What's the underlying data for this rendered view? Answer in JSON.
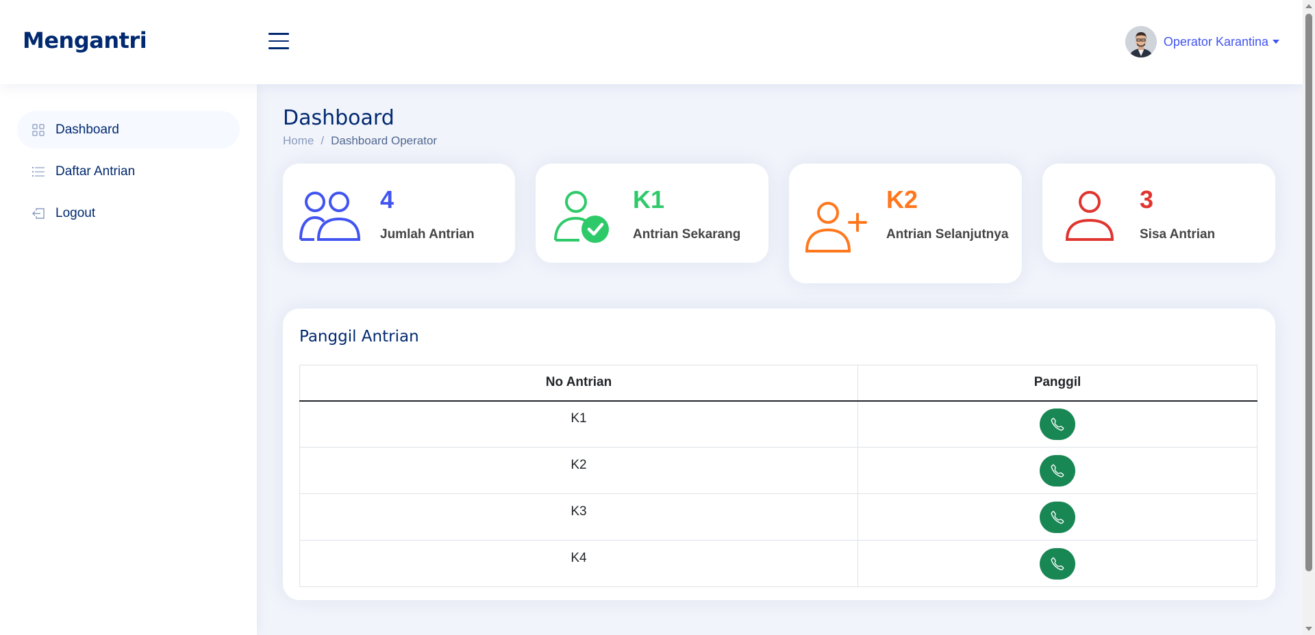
{
  "header": {
    "logo": "Mengantri",
    "profile_name": "Operator Karantina"
  },
  "sidebar": {
    "items": [
      {
        "label": "Dashboard",
        "icon": "grid-icon",
        "active": true
      },
      {
        "label": "Daftar Antrian",
        "icon": "list-icon",
        "active": false
      },
      {
        "label": "Logout",
        "icon": "box-arrow-in-left-icon",
        "active": false
      }
    ]
  },
  "page": {
    "title": "Dashboard",
    "breadcrumb": [
      "Home",
      "Dashboard Operator"
    ]
  },
  "stats": [
    {
      "value": "4",
      "label": "Jumlah Antrian",
      "color": "#4154f1",
      "icon": "people-icon"
    },
    {
      "value": "K1",
      "label": "Antrian Sekarang",
      "color": "#2eca6a",
      "icon": "person-check-icon"
    },
    {
      "value": "K2",
      "label": "Antrian Selanjutnya",
      "color": "#ff771d",
      "icon": "person-plus-icon"
    },
    {
      "value": "3",
      "label": "Sisa Antrian",
      "color": "#e0342f",
      "icon": "person-icon"
    }
  ],
  "panel": {
    "title": "Panggil Antrian",
    "columns": [
      "No Antrian",
      "Panggil"
    ],
    "rows": [
      {
        "no": "K1"
      },
      {
        "no": "K2"
      },
      {
        "no": "K3"
      },
      {
        "no": "K4"
      }
    ],
    "button_color": "#198754"
  }
}
